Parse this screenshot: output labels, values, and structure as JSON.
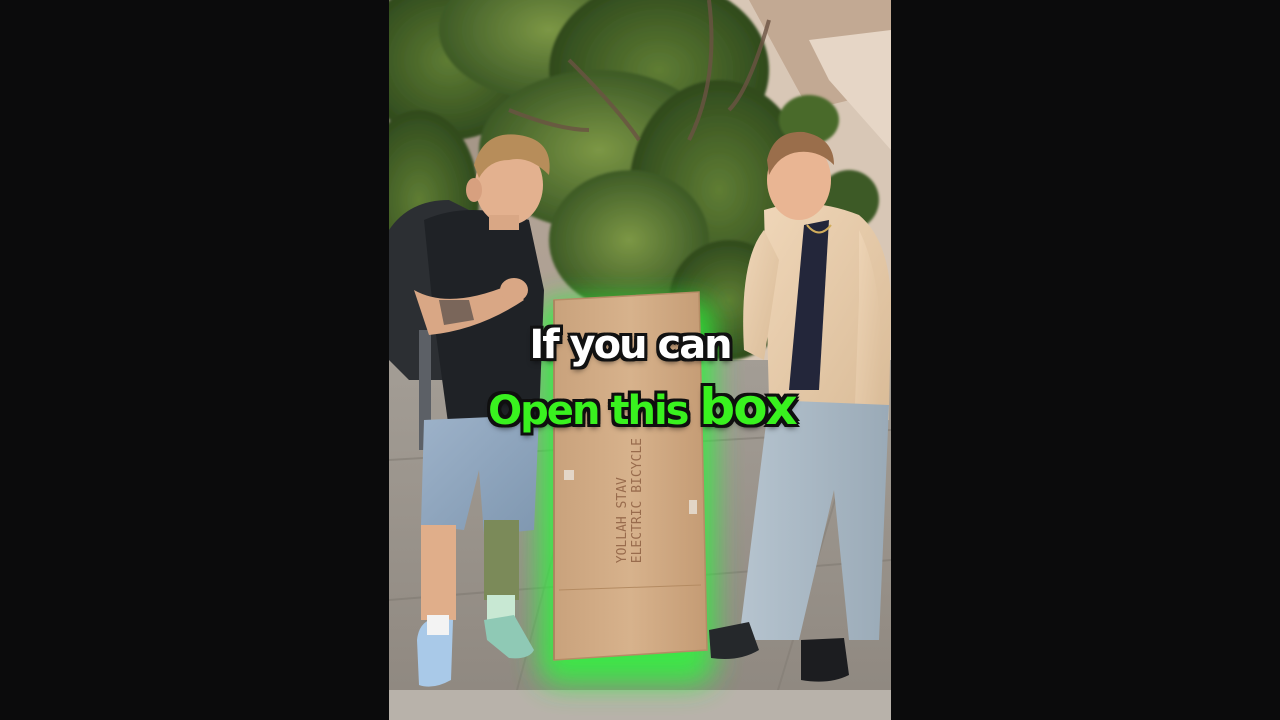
{
  "video": {
    "caption_line_1": "If you can",
    "caption_line_2_part_1": "Open this",
    "caption_line_2_part_2": "box",
    "caption_color_primary": "#ffffff",
    "caption_color_highlight": "#39f21f",
    "glow_color": "#2ff53c"
  },
  "box": {
    "print_line_1": "YOLLAH STAV",
    "print_line_2": "ELECTRIC BICYCLE"
  }
}
